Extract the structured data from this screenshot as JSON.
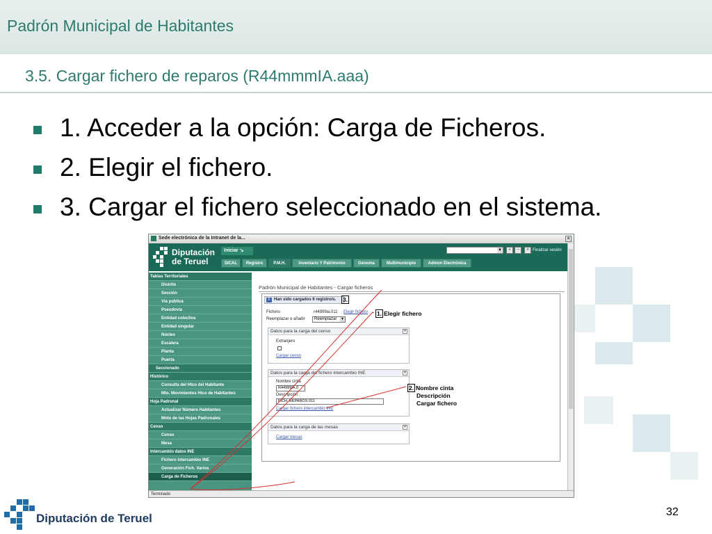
{
  "header": {
    "title": "Padrón Municipal de Habitantes"
  },
  "slide": {
    "subtitle": "3.5. Cargar fichero de reparos (R44mmmIA.aaa)",
    "bullets": [
      "1. Acceder a la opción: Carga de Ficheros.",
      "2. Elegir el fichero.",
      "3. Cargar el fichero seleccionado en el sistema."
    ],
    "page_number": "32",
    "footer_text": "Diputación de Teruel"
  },
  "colors": {
    "accent": "#2f7a6f",
    "bullet": "#1f7c6a",
    "app_green": "#1b6a57",
    "sidebar": "#4a9482",
    "annotation_line": "#d43030"
  },
  "screenshot": {
    "window_title": "Sede electrónica de la Intranet de la...",
    "logo_line1": "Diputación",
    "logo_line2": "de Teruel",
    "iniciar_label": "Iniciar",
    "finalizar_label": "Finalizar sesión",
    "menu": [
      "SICAL",
      "Registro",
      "P.M.H.",
      "Inventario Y Patrimonio",
      "Genoma",
      "Multimunicipio",
      "Admon Electrónica"
    ],
    "sidebar": [
      {
        "label": "Tablas Territoriales",
        "kind": "cat"
      },
      {
        "label": "Distrito",
        "kind": "sub"
      },
      {
        "label": "Sección",
        "kind": "sub"
      },
      {
        "label": "Vía pública",
        "kind": "sub"
      },
      {
        "label": "Pseudovía",
        "kind": "sub"
      },
      {
        "label": "Entidad colectiva",
        "kind": "sub"
      },
      {
        "label": "Entidad singular",
        "kind": "sub"
      },
      {
        "label": "Núcleo",
        "kind": "sub"
      },
      {
        "label": "Escalera",
        "kind": "sub"
      },
      {
        "label": "Planta",
        "kind": "sub"
      },
      {
        "label": "Puerta",
        "kind": "sub"
      },
      {
        "label": "Seccionado",
        "kind": "cat2"
      },
      {
        "label": "Histórico",
        "kind": "cat"
      },
      {
        "label": "Consulta del Htco del Habitante",
        "kind": "sub"
      },
      {
        "label": "Mto. Movimientos Htco de Habitantes",
        "kind": "sub"
      },
      {
        "label": "Hoja Padronal",
        "kind": "cat"
      },
      {
        "label": "Actualizar Número Habitantes",
        "kind": "sub"
      },
      {
        "label": "Mnto de las Hojas Padronales",
        "kind": "sub"
      },
      {
        "label": "Censo",
        "kind": "cat"
      },
      {
        "label": "Censo",
        "kind": "sub"
      },
      {
        "label": "Mesa",
        "kind": "sub"
      },
      {
        "label": "Intercambio datos INE",
        "kind": "cat"
      },
      {
        "label": "Fichero intercambio INE",
        "kind": "sub"
      },
      {
        "label": "Generación Fich. Varios",
        "kind": "sub"
      },
      {
        "label": "Carga de Ficheros",
        "kind": "active"
      }
    ],
    "content_title": "Padrón Municipal de Habitantes - Cargar ficheros",
    "notice": "Han sido cargados 6 registro/s.",
    "fichero_label": "Fichero",
    "fichero_value": "r44999ia.011",
    "elegir_link": "Elegir fichero",
    "reemplazar_label": "Reemplazar o añadir",
    "reemplazar_value": "Reemplazar",
    "sec_censo_title": "Datos para la carga del censo",
    "extranjero_label": "Extranjero",
    "cargar_censo_link": "Cargar censo",
    "sec_ine_title": "Datos para la carga del fichero intercambio INE",
    "nombre_cinta_label": "Nombre cinta",
    "nombre_cinta_value": "R44999IA.0",
    "descripcion_label": "Descripción",
    "descripcion_value": "FICH. REPAROS 011",
    "cargar_ine_link": "Cargar fichero intercambio INE",
    "sec_mesas_title": "Datos para la carga de las mesas",
    "cargar_mesas_link": "Cargar mesas",
    "status_text": "Terminado",
    "callout1_num": "1.",
    "callout1_text": "Elegir fichero",
    "callout2_num": "2.",
    "callout2_lines": [
      "Nombre cinta",
      "Descripción",
      "Cargar fichero"
    ],
    "callout3_num": "3."
  }
}
